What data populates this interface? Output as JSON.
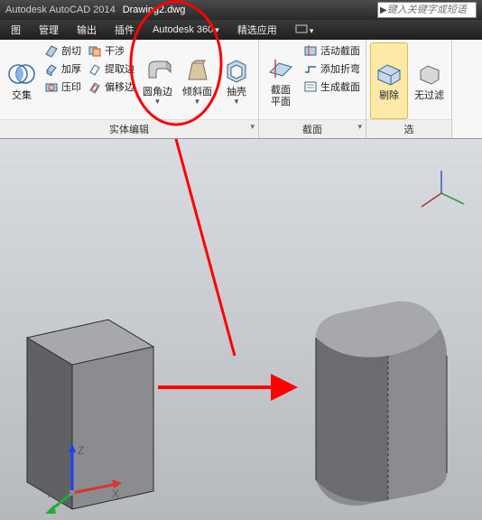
{
  "titlebar": {
    "app": "Autodesk AutoCAD 2014",
    "file": "Drawing2.dwg",
    "search_placeholder": "键入关键字或短语"
  },
  "menu": {
    "items": [
      "图",
      "管理",
      "输出",
      "插件",
      "Autodesk 360",
      "精选应用"
    ]
  },
  "ribbon": {
    "panel1": {
      "title": "实体编辑",
      "left": {
        "big": "交集"
      },
      "col1": [
        "剖切",
        "加厚",
        "压印"
      ],
      "col2": [
        "干涉",
        "提取边",
        "偏移边"
      ],
      "big1": "圆角边",
      "big2": "倾斜面",
      "big3": "抽壳"
    },
    "panel2": {
      "title": "截面",
      "big": "截面\n平面",
      "rows": [
        "活动截面",
        "添加折弯",
        "生成截面"
      ]
    },
    "panel3": {
      "b1": "剔除",
      "b2": "无过滤"
    },
    "panel3title": "选"
  },
  "colors": {
    "accent": "#ff0000"
  }
}
